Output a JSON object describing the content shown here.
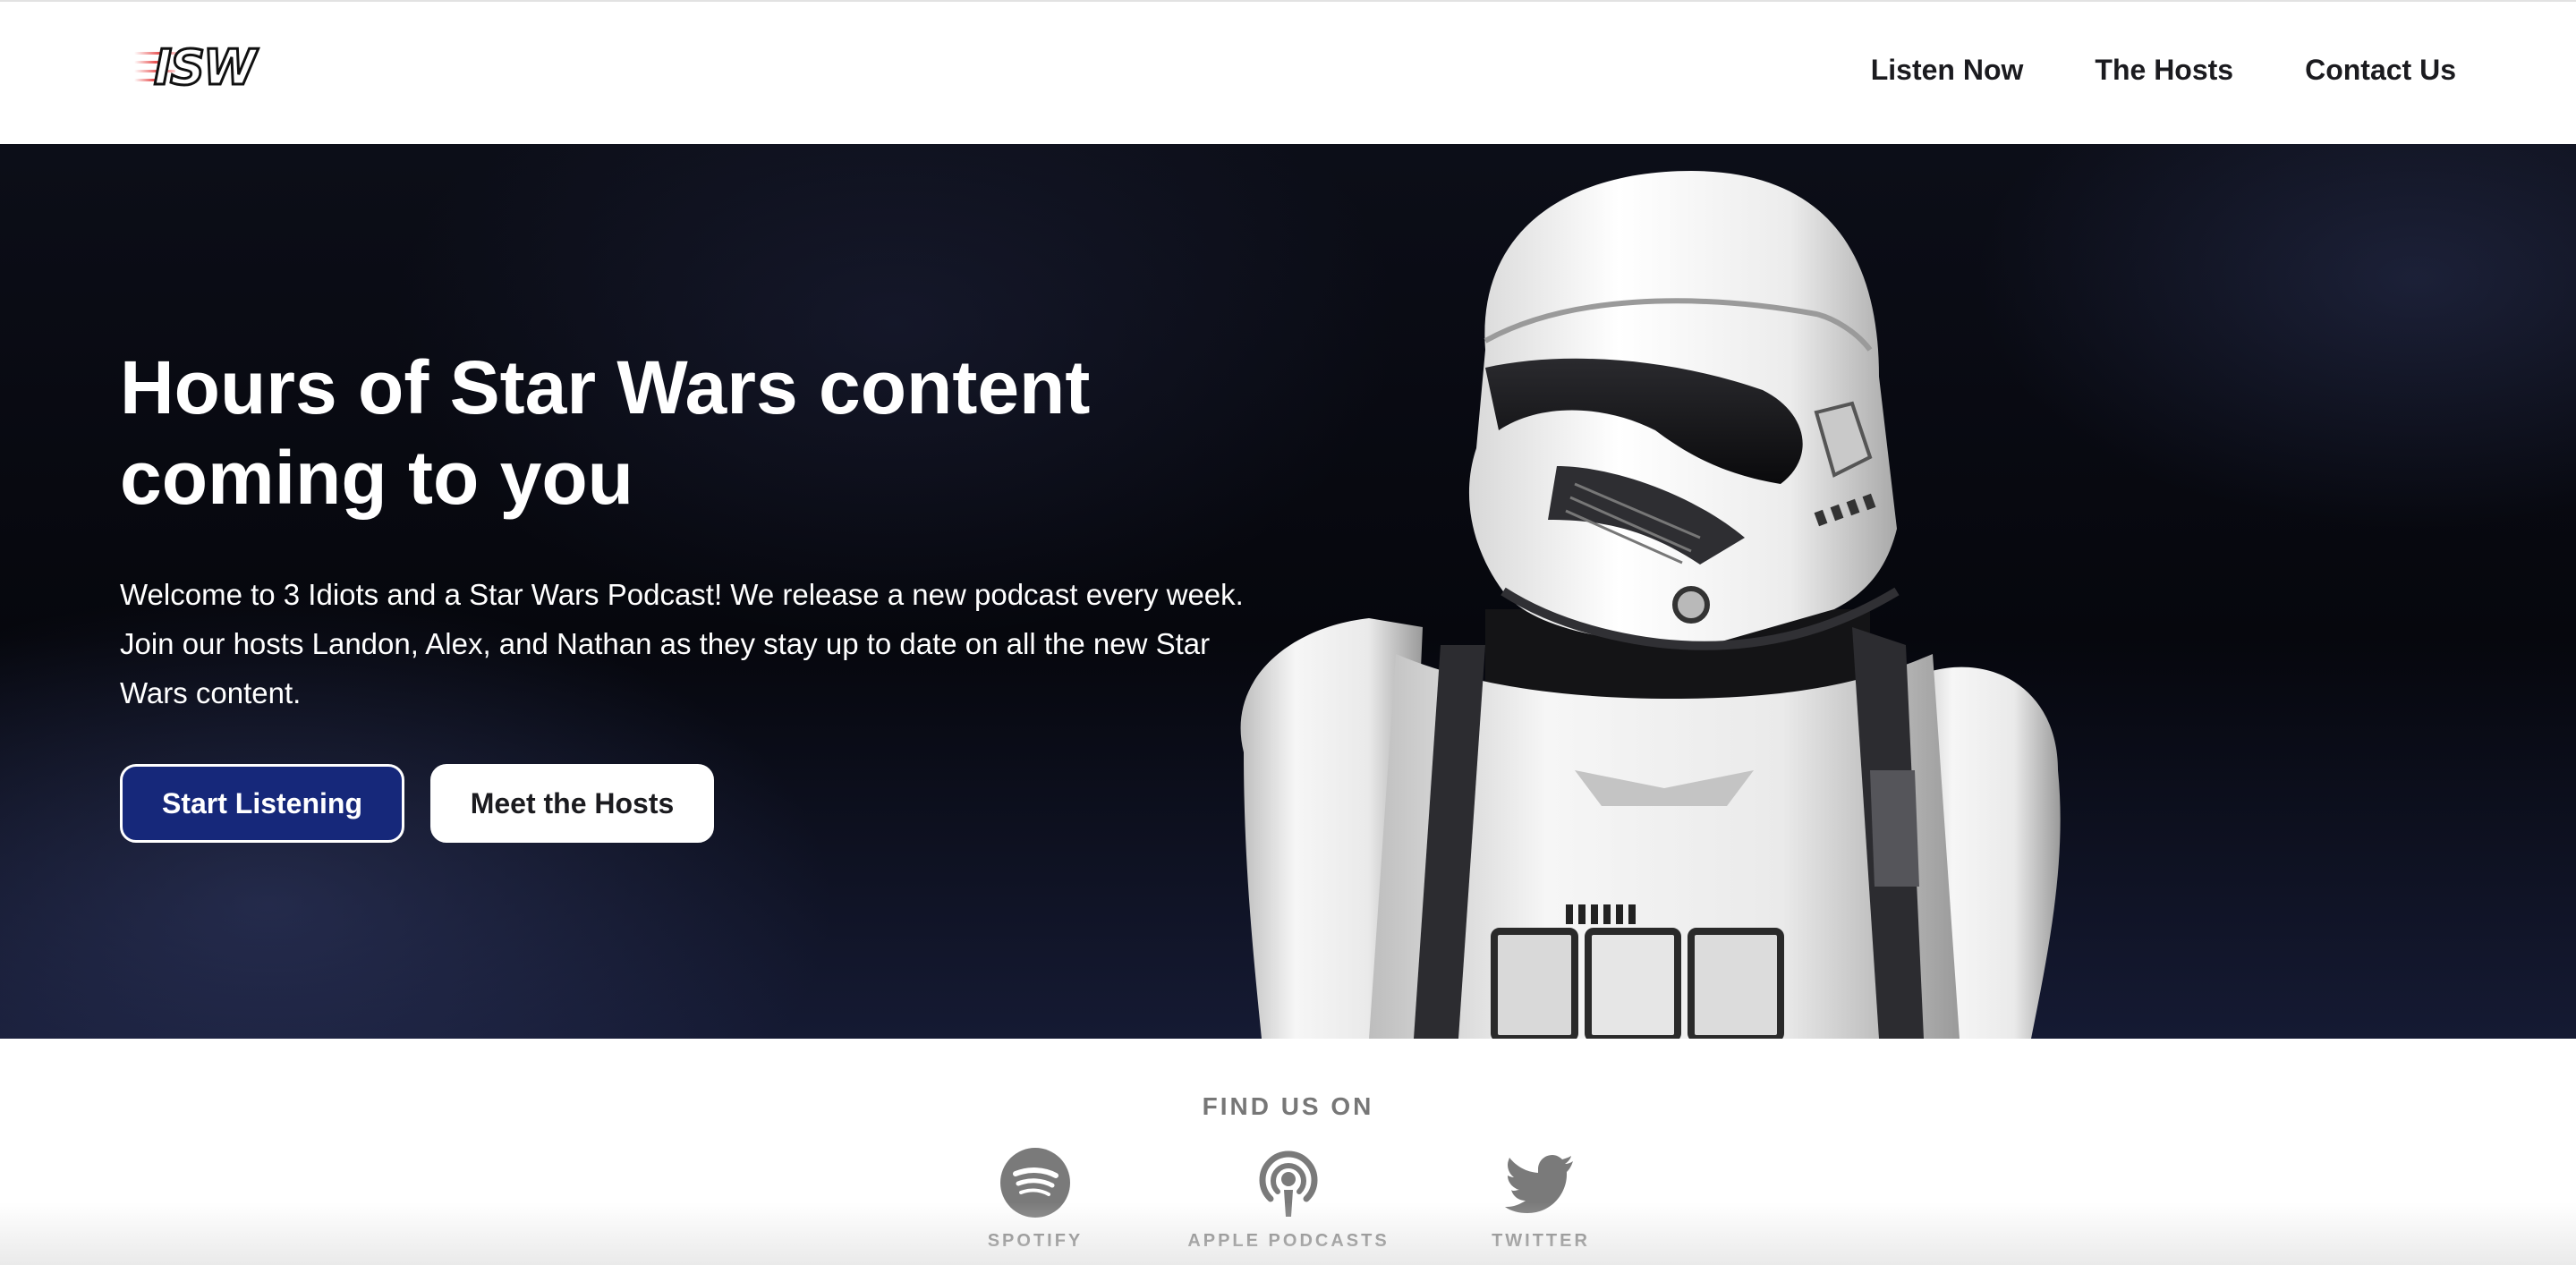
{
  "header": {
    "logo_text": "ISW",
    "nav": [
      {
        "label": "Listen Now"
      },
      {
        "label": "The Hosts"
      },
      {
        "label": "Contact Us"
      }
    ]
  },
  "hero": {
    "title": "Hours of Star Wars content coming to you",
    "description": "Welcome to 3 Idiots and a Star Wars Podcast! We release a new podcast every week. Join our hosts Landon, Alex, and Nathan as they stay up to date on all the new Star Wars content.",
    "primary_button": "Start Listening",
    "secondary_button": "Meet the Hosts",
    "image_icon": "stormtrooper-image"
  },
  "find_us": {
    "title": "FIND US ON",
    "platforms": [
      {
        "label": "SPOTIFY",
        "icon": "spotify-icon"
      },
      {
        "label": "APPLE PODCASTS",
        "icon": "apple-podcasts-icon"
      },
      {
        "label": "TWITTER",
        "icon": "twitter-icon"
      }
    ]
  },
  "colors": {
    "primary_button_bg": "#16287a",
    "hero_bg": "#06070d",
    "muted_text": "#777777"
  }
}
